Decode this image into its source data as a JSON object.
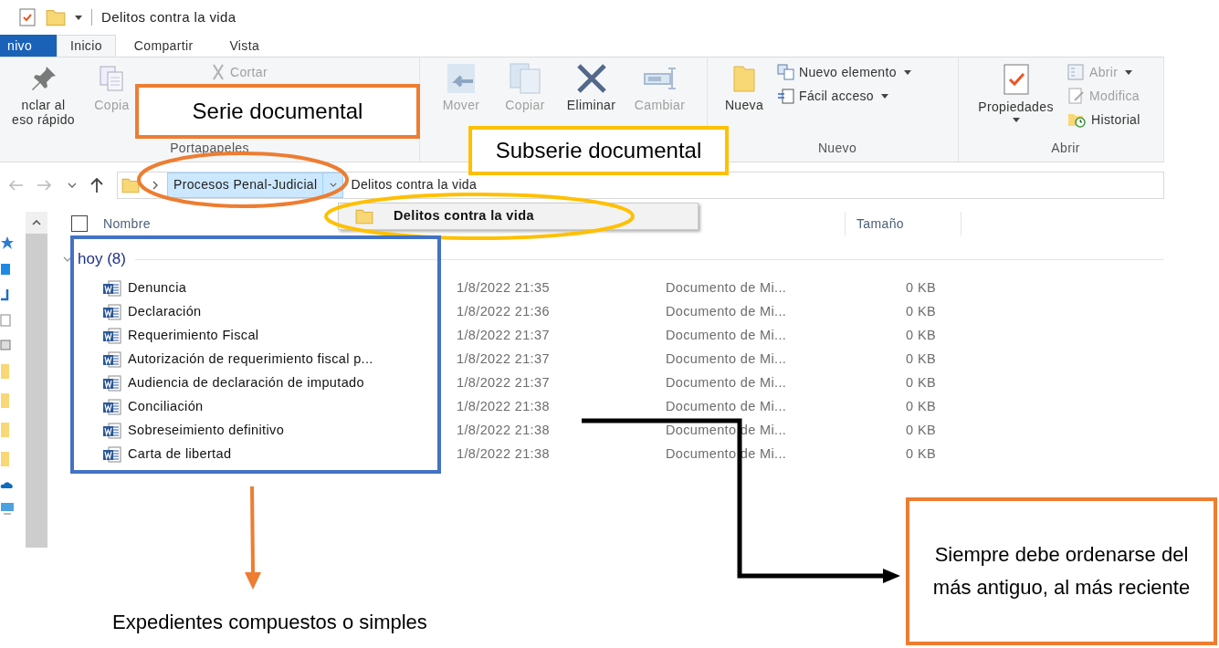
{
  "window": {
    "title": "Delitos contra la vida"
  },
  "tabs": [
    {
      "label": "nivo",
      "selected": false,
      "kind": "file"
    },
    {
      "label": "Inicio",
      "selected": true,
      "kind": "tab"
    },
    {
      "label": "Compartir",
      "selected": false,
      "kind": "tab"
    },
    {
      "label": "Vista",
      "selected": false,
      "kind": "tab"
    }
  ],
  "ribbon": [
    {
      "label": "Portapapeles",
      "buttons": [
        {
          "kind": "large",
          "lines": [
            "nclar al",
            "eso rápido"
          ],
          "disabled": false
        },
        {
          "kind": "large",
          "lines": [
            "Copia"
          ],
          "disabled": true
        },
        {
          "kind": "small",
          "label": "Cortar",
          "disabled": true,
          "dropdown": false
        }
      ]
    },
    {
      "buttons": [
        {
          "kind": "large",
          "lines": [
            "Mover"
          ],
          "disabled": true
        },
        {
          "kind": "large",
          "lines": [
            "Copiar"
          ],
          "disabled": true
        },
        {
          "kind": "large",
          "lines": [
            "Eliminar"
          ],
          "disabled": false
        },
        {
          "kind": "large",
          "lines": [
            "Cambiar"
          ],
          "disabled": true
        }
      ]
    },
    {
      "label": "Nuevo",
      "buttons": [
        {
          "kind": "large",
          "lines": [
            "Nueva"
          ],
          "disabled": false
        },
        {
          "kind": "small",
          "label": "Nuevo elemento",
          "disabled": false,
          "dropdown": true
        },
        {
          "kind": "small",
          "label": "Fácil acceso",
          "disabled": false,
          "dropdown": true
        }
      ]
    },
    {
      "label": "Abrir",
      "buttons": [
        {
          "kind": "large",
          "lines": [
            "Propiedades"
          ],
          "disabled": false,
          "dropdown": true
        },
        {
          "kind": "small",
          "label": "Abrir",
          "disabled": true,
          "dropdown": true
        },
        {
          "kind": "small",
          "label": "Modifica",
          "disabled": true,
          "dropdown": false
        },
        {
          "kind": "small",
          "label": "Historial",
          "disabled": false,
          "dropdown": false
        }
      ]
    }
  ],
  "address": {
    "path": [
      {
        "label": "Procesos Penal-Judicial",
        "selected": true
      },
      {
        "label": "Delitos contra la vida",
        "selected": false
      }
    ]
  },
  "dropdown_menu": {
    "items": [
      {
        "label": "Delitos contra la vida"
      }
    ]
  },
  "select_all": {
    "checked": false
  },
  "columns": [
    {
      "label": "Nombre"
    },
    {
      "label": "Tamaño"
    }
  ],
  "group": {
    "label": "hoy (8)",
    "expanded": true,
    "rows": [
      {
        "name": "Denuncia",
        "date": "1/8/2022 21:35",
        "type": "Documento de Mi...",
        "size": "0 KB"
      },
      {
        "name": "Declaración",
        "date": "1/8/2022 21:36",
        "type": "Documento de Mi...",
        "size": "0 KB"
      },
      {
        "name": "Requerimiento Fiscal",
        "date": "1/8/2022 21:37",
        "type": "Documento de Mi...",
        "size": "0 KB"
      },
      {
        "name": "Autorización de requerimiento fiscal p...",
        "date": "1/8/2022 21:37",
        "type": "Documento de Mi...",
        "size": "0 KB"
      },
      {
        "name": "Audiencia de declaración de imputado",
        "date": "1/8/2022 21:37",
        "type": "Documento de Mi...",
        "size": "0 KB"
      },
      {
        "name": "Conciliación",
        "date": "1/8/2022 21:38",
        "type": "Documento de Mi...",
        "size": "0 KB"
      },
      {
        "name": "Sobreseimiento definitivo",
        "date": "1/8/2022 21:38",
        "type": "Documento de Mi...",
        "size": "0 KB"
      },
      {
        "name": "Carta de libertad",
        "date": "1/8/2022 21:38",
        "type": "Documento de Mi...",
        "size": "0 KB"
      }
    ]
  },
  "annotations": [
    {
      "kind": "label",
      "text": "Serie documental",
      "color": "#ed7d31"
    },
    {
      "kind": "label",
      "text": "Subserie documental",
      "color": "#ffc000"
    },
    {
      "kind": "caption",
      "text": "Expedientes compuestos o simples"
    },
    {
      "kind": "note",
      "text": "Siempre debe ordenarse del más antiguo, al más reciente",
      "color": "#ed7d31"
    }
  ]
}
